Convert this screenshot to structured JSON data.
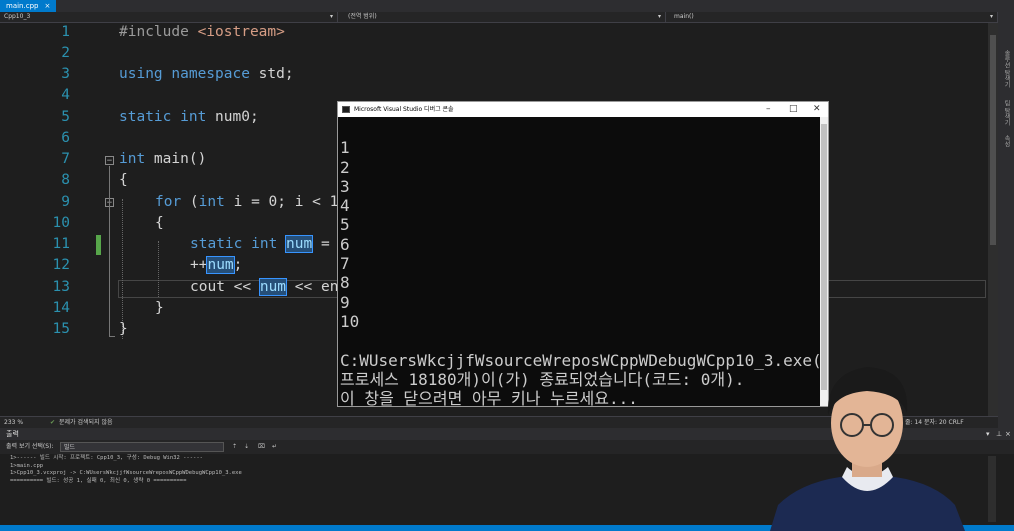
{
  "tab": {
    "label": "main.cpp",
    "close": "×"
  },
  "nav": {
    "project": "Cpp10_3",
    "scope": "(전역 범위)",
    "function": "main()"
  },
  "editor": {
    "line_numbers": [
      "1",
      "2",
      "3",
      "4",
      "5",
      "6",
      "7",
      "8",
      "9",
      "10",
      "11",
      "12",
      "13",
      "14",
      "15"
    ],
    "lines": {
      "l1_a": "#include ",
      "l1_b": "<iostream>",
      "l3_a": "using namespace",
      "l3_b": " std;",
      "l5_a": "static int",
      "l5_b": " num0;",
      "l7_a": "int",
      "l7_b": " main()",
      "l8": "{",
      "l9_a": "for",
      "l9_b": " (",
      "l9_c": "int",
      "l9_d": " i = 0; i < 1",
      "l10": "{",
      "l11_a": "static int",
      "l11_b": " ",
      "l11_c": "num",
      "l11_d": " =",
      "l12_a": "++",
      "l12_b": "num",
      "l12_c": ";",
      "l13_a": "cout << ",
      "l13_b": "num",
      "l13_c": " << en",
      "l14": "}",
      "l15": "}"
    },
    "fold_minus": "−",
    "zoom": "233 %",
    "issues": "문제가 검색되지 않음",
    "position": "줄: 14   문자: 20   CRLF"
  },
  "console": {
    "title": "Microsoft Visual Studio 디버그 콘솔",
    "min": "–",
    "max": "□",
    "close": "✕",
    "output": [
      "1",
      "2",
      "3",
      "4",
      "5",
      "6",
      "7",
      "8",
      "9",
      "10",
      "",
      "C:WUsersWkcjjfWsourceWreposWCppWDebugWCpp10_3.exe(",
      "프로세스 18180개)이(가) 종료되었습니다(코드: 0개).",
      "이 창을 닫으려면 아무 키나 누르세요..."
    ]
  },
  "output_panel": {
    "title": "출력",
    "show_label": "출력 보기 선택(S):",
    "source": "빌드",
    "lines": [
      "1>------ 빌드 시작: 프로젝트: Cpp10_3, 구성: Debug Win32 ------",
      "1>main.cpp",
      "1>Cpp10_3.vcxproj -> C:WUsersWkcjjfWsourceWreposWCppWDebugWCpp10_3.exe",
      "========== 빌드: 성공 1, 실패 0, 최신 0, 생략 0 =========="
    ]
  },
  "side_labels": [
    "솔루션 탐색기",
    "팀 탐색기",
    "속성"
  ]
}
